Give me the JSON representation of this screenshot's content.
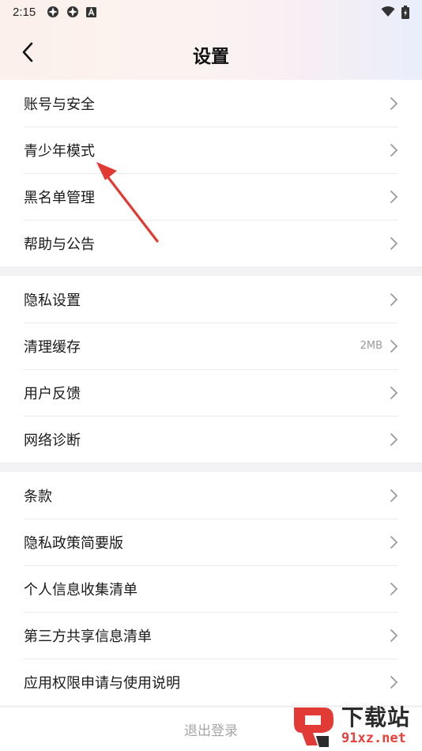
{
  "status_bar": {
    "time": "2:15"
  },
  "header": {
    "title": "设置"
  },
  "groups": [
    {
      "items": [
        {
          "label": "账号与安全"
        },
        {
          "label": "青少年模式"
        },
        {
          "label": "黑名单管理"
        },
        {
          "label": "帮助与公告"
        }
      ]
    },
    {
      "items": [
        {
          "label": "隐私设置"
        },
        {
          "label": "清理缓存",
          "value": "2MB"
        },
        {
          "label": "用户反馈"
        },
        {
          "label": "网络诊断"
        }
      ]
    },
    {
      "items": [
        {
          "label": "条款"
        },
        {
          "label": "隐私政策简要版"
        },
        {
          "label": "个人信息收集清单"
        },
        {
          "label": "第三方共享信息清单"
        },
        {
          "label": "应用权限申请与使用说明"
        }
      ]
    }
  ],
  "logout": {
    "label": "退出登录"
  },
  "watermark": {
    "text": "下载站",
    "url": "91xz.net"
  },
  "colors": {
    "annotation_arrow": "#e03a32",
    "watermark_url": "#e73f3a"
  }
}
